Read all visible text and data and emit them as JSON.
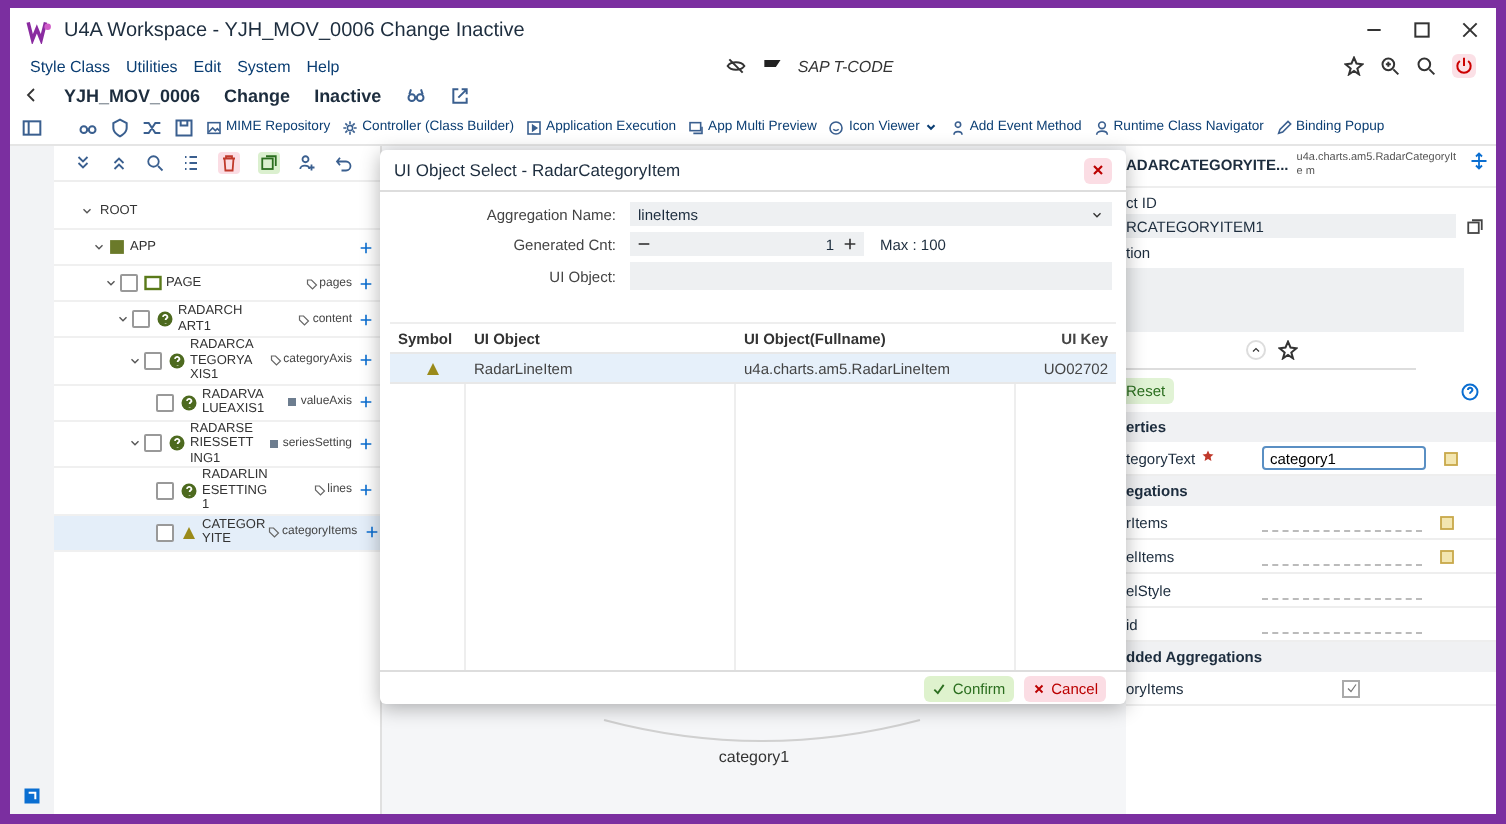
{
  "window": {
    "title": "U4A Workspace - YJH_MOV_0006 Change Inactive"
  },
  "menu": [
    "Style Class",
    "Utilities",
    "Edit",
    "System",
    "Help"
  ],
  "tcode": {
    "placeholder": "SAP T-CODE"
  },
  "header": {
    "program": "YJH_MOV_0006",
    "mode": "Change",
    "status": "Inactive"
  },
  "toolbar": [
    {
      "label": "MIME Repository"
    },
    {
      "label": "Controller (Class Builder)"
    },
    {
      "label": "Application Execution"
    },
    {
      "label": "App Multi Preview"
    },
    {
      "label": "Icon Viewer",
      "dropdown": true
    },
    {
      "label": "Add Event Method"
    },
    {
      "label": "Runtime Class Navigator"
    },
    {
      "label": "Binding Popup"
    }
  ],
  "tree": [
    {
      "name": "ROOT",
      "kind": "root",
      "expanded": true,
      "selected": false,
      "children": [
        {
          "name": "APP",
          "kind": "app",
          "expanded": true,
          "selected": false,
          "children": [
            {
              "name": "PAGE",
              "kind": "page",
              "checked": false,
              "expanded": true,
              "selected": false,
              "aggregation": {
                "name": "pages",
                "kind": "multiple"
              },
              "children": [
                {
                  "name": "RADARCHART1",
                  "kind": "control",
                  "checked": false,
                  "expanded": true,
                  "selected": false,
                  "aggregation": {
                    "name": "content",
                    "kind": "multiple"
                  },
                  "children": [
                    {
                      "name": "RADARCATEGORYAXIS1",
                      "kind": "control",
                      "checked": false,
                      "expanded": true,
                      "selected": false,
                      "aggregation": {
                        "name": "categoryAxis",
                        "kind": "multiple"
                      },
                      "children": [
                        {
                          "name": "RADARVALUEAXIS1",
                          "kind": "control",
                          "checked": false,
                          "selected": false,
                          "aggregation": {
                            "name": "valueAxis",
                            "kind": "single"
                          }
                        }
                      ]
                    },
                    {
                      "name": "RADARSERIESSETTING1",
                      "kind": "control",
                      "checked": false,
                      "expanded": true,
                      "selected": false,
                      "aggregation": {
                        "name": "seriesSetting",
                        "kind": "single"
                      },
                      "children": [
                        {
                          "name": "RADARLINESETTING1",
                          "kind": "control",
                          "checked": false,
                          "selected": false,
                          "aggregation": {
                            "name": "lines",
                            "kind": "multiple"
                          }
                        },
                        {
                          "name": "CATEGORYITE",
                          "kind": "item",
                          "checked": false,
                          "selected": true,
                          "aggregation": {
                            "name": "categoryItems",
                            "kind": "multiple"
                          }
                        }
                      ]
                    }
                  ]
                }
              ]
            }
          ]
        }
      ]
    }
  ],
  "canvas": {
    "label": "category1"
  },
  "inspector": {
    "title": "ADARCATEGORYITE...",
    "class_name": "u4a.charts.am5.RadarCategoryIte m",
    "id_label": "ct ID",
    "id_value": "RCATEGORYITEM1",
    "description_label": "tion",
    "reset": "Reset",
    "sections": [
      {
        "title": "erties",
        "rows": [
          {
            "name": "tegoryText",
            "kind": "text",
            "required": true,
            "value": "category1"
          }
        ]
      },
      {
        "title": "egations",
        "rows": [
          {
            "name": "rItems",
            "kind": "binding"
          },
          {
            "name": "elItems",
            "kind": "binding"
          },
          {
            "name": "elStyle",
            "kind": "line"
          },
          {
            "name": "id",
            "kind": "line"
          }
        ]
      },
      {
        "title": "dded Aggregations",
        "rows": [
          {
            "name": "oryItems",
            "kind": "check",
            "checked": true
          }
        ]
      }
    ]
  },
  "dialog": {
    "title": "UI Object Select - RadarCategoryItem",
    "aggregation_label": "Aggregation Name:",
    "aggregation_value": "lineItems",
    "count_label": "Generated Cnt:",
    "count_value": "1",
    "count_max": "Max : 100",
    "object_label": "UI Object:",
    "columns": [
      "Symbol",
      "UI Object",
      "UI Object(Fullname)",
      "UI Key"
    ],
    "rows": [
      {
        "name": "RadarLineItem",
        "fullname": "u4a.charts.am5.RadarLineItem",
        "key": "UO02702",
        "selected": true
      }
    ],
    "buttons": [
      {
        "label": "Confirm",
        "kind": "confirm"
      },
      {
        "label": "Cancel",
        "kind": "cancel"
      }
    ]
  }
}
